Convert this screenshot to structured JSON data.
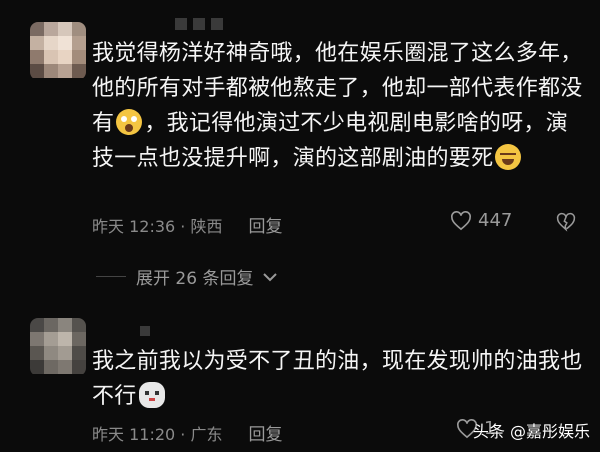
{
  "comments": [
    {
      "text_a": "我觉得杨洋好神奇哦，他在娱乐圈混了这么多年，他的所有对手都被他熬走了，他却一部代表作都没有",
      "text_b": "，我记得他演过不少电视剧电影啥的呀，演技一点也没提升啊，演的这部剧油的要死",
      "emoji_a": "shocked-face",
      "emoji_b": "grinning-sweat-face",
      "time": "昨天 12:36 · 陕西",
      "reply_label": "回复",
      "like_count": "447"
    },
    {
      "text_a": "我之前我以为受不了丑的油，现在发现帅的油我也不行",
      "emoji_a": "cat-face",
      "time": "昨天 11:20 · 广东",
      "reply_label": "回复",
      "like_count": "1"
    }
  ],
  "expand_replies": "展开 26 条回复",
  "watermark": "头条 @嘉彤娱乐",
  "colors": {
    "background": "#0b0b0b",
    "text": "#f5f5f5",
    "meta": "#8a8a8a"
  }
}
